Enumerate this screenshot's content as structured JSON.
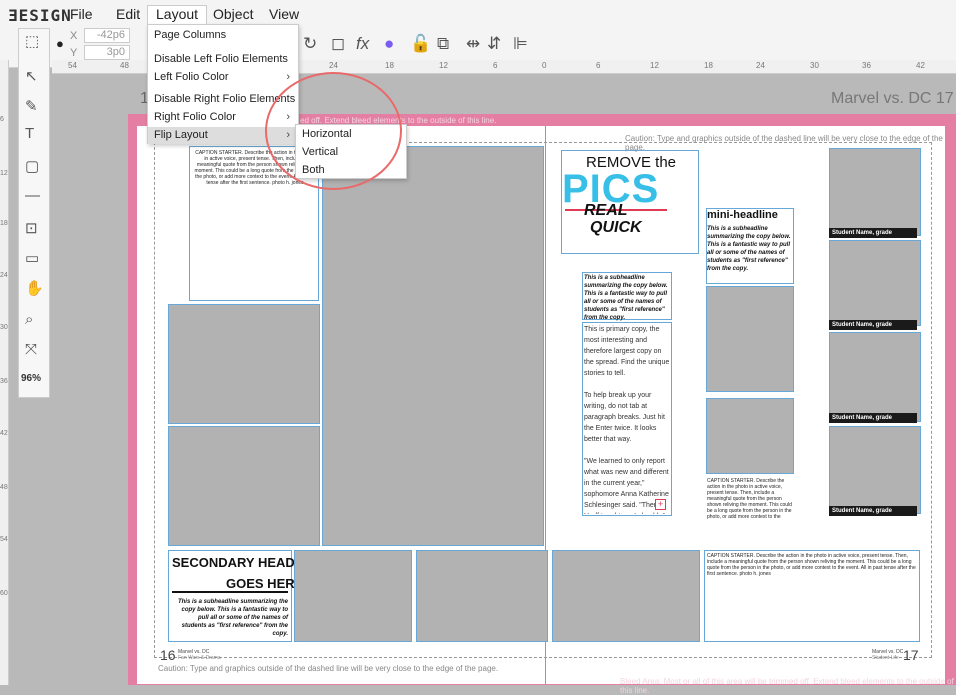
{
  "app": {
    "logo": "ƎESIGN",
    "menus": [
      "File",
      "Edit",
      "Layout",
      "Object",
      "View"
    ],
    "active_menu": "Layout"
  },
  "coords": {
    "x_label": "X",
    "x_value": "-42p6",
    "y_label": "Y",
    "y_value": "3p0"
  },
  "ruler": {
    "h_ticks": [
      "54",
      "48",
      "24",
      "18",
      "12",
      "6",
      "0",
      "6",
      "12",
      "18",
      "24",
      "30",
      "36",
      "42"
    ],
    "v_ticks": [
      "6",
      "12",
      "18",
      "24",
      "30",
      "36",
      "42",
      "48",
      "54",
      "60"
    ]
  },
  "zoom": "96%",
  "layout_menu": {
    "items": [
      "Page Columns",
      "Disable Left Folio Elements",
      "Left Folio Color",
      "Disable Right Folio Elements",
      "Right Folio Color",
      "Flip Layout"
    ],
    "highlighted": "Flip Layout"
  },
  "flip_submenu": {
    "items": [
      "Horizontal",
      "Vertical",
      "Both"
    ]
  },
  "page": {
    "left_number": "1",
    "right_header": "Marvel vs. DC",
    "right_page": "17",
    "bleed_top": "Bleed Area: Most or all of this area will be trimmed off. Extend bleed elements to the outside of this line.",
    "bleed_top_short": "ed off. Extend bleed elements to the outside of this line.",
    "bleed_bottom": "Bleed Area: Most or all of this area will be trimmed off. Extend bleed elements to the outside of this line.",
    "caution_top": "Caution: Type and graphics outside of the dashed line will be very close to the edge of the page.",
    "caution_bottom": "Caution: Type and graphics outside of the dashed line will be very close to the edge of the page.",
    "folio_left_num": "16",
    "folio_left_title": "Marvel vs. DC",
    "folio_left_sub": "Fan Wars & Drama",
    "folio_right_num": "17",
    "folio_right_title": "Marvel vs. DC",
    "folio_right_sub": "Student Life"
  },
  "content": {
    "remove": "REMOVE the",
    "pics": "PICS",
    "real": "REAL",
    "quick": "QUICK",
    "mini_headline": "mini-headline",
    "subheadline": "This is a subheadline summarizing the copy below. This is a fantastic way to pull all or some of the names of students as \"first reference\" from the copy.",
    "caption": "CAPTION STARTER. Describe the action in the photo in active voice, present tense. Then, include a meaningful quote from the person shown reliving the moment. This could be a long quote from the person in the photo, or add more context to the event. All in past tense after the first sentence. photo h. jones",
    "body": "This is primary copy, the most interesting and therefore largest copy on the spread. Find the unique stories to tell.\n\nTo help break up your writing, do not tab at paragraph breaks. Just hit the Enter twice. It looks better that way.\n\n\"We learned to only report what was new and different in the current year,\" sophomore Anna Katherine Schlesinger said. \"Then, Herff taught me I shouldn't actually write it from my desk, but to get out and talk to people face-to-face and use their words. That's a big",
    "secondary_1": "SECONDARY HEADLINE",
    "secondary_2": "GOES HERE",
    "student_label": "Student Name, grade"
  },
  "colors": {
    "bleed": "#e47fa3",
    "frame": "#67a8d6",
    "highlight": "#e86a6a",
    "pics": "#38bfe8"
  }
}
